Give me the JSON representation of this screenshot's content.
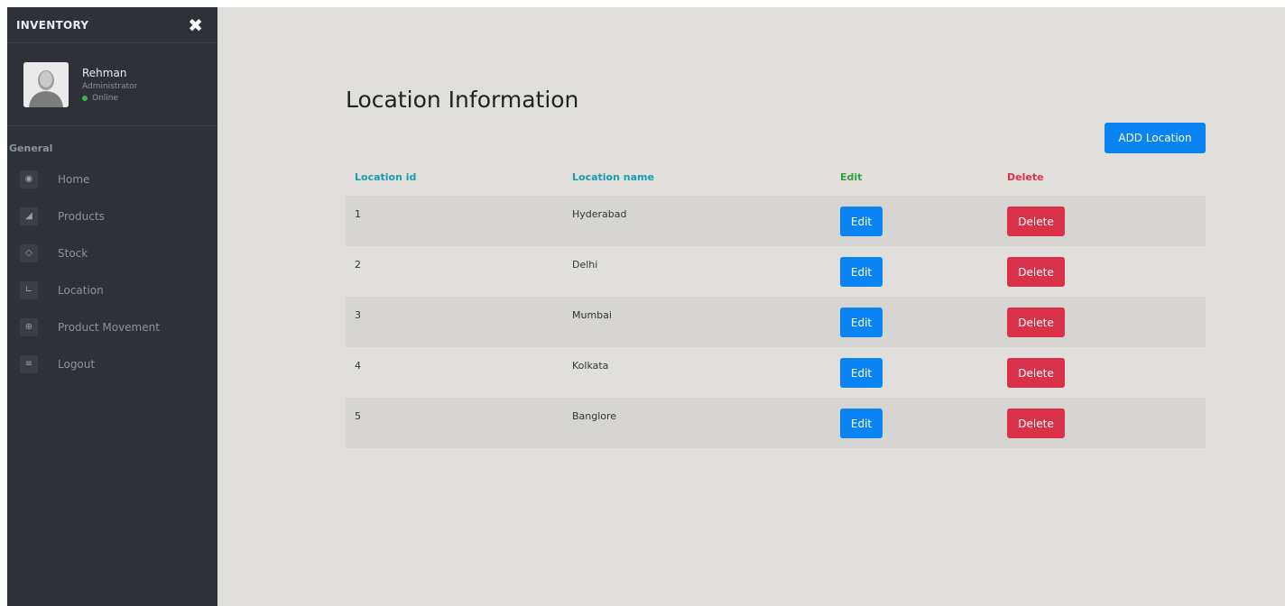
{
  "sidebar": {
    "title": "INVENTORY",
    "profile": {
      "name": "Rehman",
      "role": "Administrator",
      "status": "Online"
    },
    "section": "General",
    "items": [
      {
        "label": "Home",
        "icon": "dashboard-icon"
      },
      {
        "label": "Products",
        "icon": "cart-icon"
      },
      {
        "label": "Stock",
        "icon": "diamond-icon"
      },
      {
        "label": "Location",
        "icon": "chart-icon"
      },
      {
        "label": "Product Movement",
        "icon": "globe-icon"
      },
      {
        "label": "Logout",
        "icon": "menu-icon"
      }
    ]
  },
  "main": {
    "title": "Location Information",
    "add_button": "ADD Location",
    "table": {
      "headers": [
        "Location id",
        "Location name",
        "Edit",
        "Delete"
      ],
      "header_colors": [
        "#1a9bb2",
        "#1a9bb2",
        "#2f9e3b",
        "#d9314a"
      ],
      "edit_label": "Edit",
      "delete_label": "Delete",
      "rows": [
        {
          "id": "1",
          "name": "Hyderabad"
        },
        {
          "id": "2",
          "name": "Delhi"
        },
        {
          "id": "3",
          "name": "Mumbai"
        },
        {
          "id": "4",
          "name": "Kolkata"
        },
        {
          "id": "5",
          "name": "Banglore"
        }
      ]
    }
  },
  "colors": {
    "sidebar_bg": "#2e3238",
    "content_bg": "#e0dfdb",
    "primary": "#0a84f2",
    "danger": "#d9314a",
    "online": "#3cb54a"
  }
}
